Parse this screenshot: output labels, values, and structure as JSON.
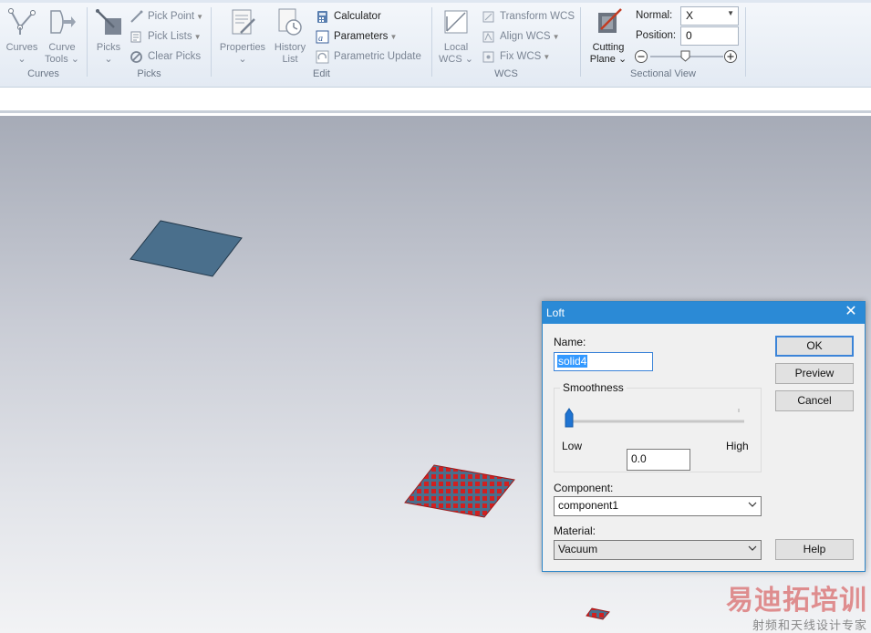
{
  "ribbon": {
    "groups": {
      "curves": "Curves",
      "picks": "Picks",
      "edit": "Edit",
      "wcs": "WCS",
      "sectional_view": "Sectional View"
    },
    "curves_btn": {
      "line1": "Curves",
      "line2": "⌄"
    },
    "curve_tools_btn": {
      "line1": "Curve",
      "line2": "Tools ⌄"
    },
    "picks_btn": {
      "line1": "Picks",
      "line2": "⌄"
    },
    "pick_point": "Pick Point",
    "pick_lists": "Pick Lists",
    "clear_picks": "Clear Picks",
    "properties_btn": {
      "line1": "Properties",
      "line2": "⌄"
    },
    "history_btn": {
      "line1": "History",
      "line2": "List"
    },
    "calculator": "Calculator",
    "parameters": "Parameters",
    "parametric_update": "Parametric Update",
    "local_wcs_btn": {
      "line1": "Local",
      "line2": "WCS ⌄"
    },
    "transform_wcs": "Transform WCS",
    "align_wcs": "Align WCS",
    "fix_wcs": "Fix WCS",
    "cutting_plane_btn": {
      "line1": "Cutting",
      "line2": "Plane ⌄"
    },
    "normal_label": "Normal:",
    "normal_value": "X",
    "position_label": "Position:",
    "position_value": "0"
  },
  "dialog": {
    "title": "Loft",
    "name_label": "Name:",
    "name_value": "solid4",
    "smoothness_title": "Smoothness",
    "low_label": "Low",
    "high_label": "High",
    "smoothness_value": "0.0",
    "smoothness_level": 0.0,
    "component_label": "Component:",
    "component_value": "component1",
    "material_label": "Material:",
    "material_value": "Vacuum",
    "ok": "OK",
    "preview": "Preview",
    "cancel": "Cancel",
    "help": "Help"
  },
  "watermark": {
    "brand": "易迪拓培训",
    "tagline": "射频和天线设计专家"
  },
  "colors": {
    "accent": "#2b8ad6",
    "plate_fill": "#4a6f8c",
    "pick_red": "#d02020"
  }
}
